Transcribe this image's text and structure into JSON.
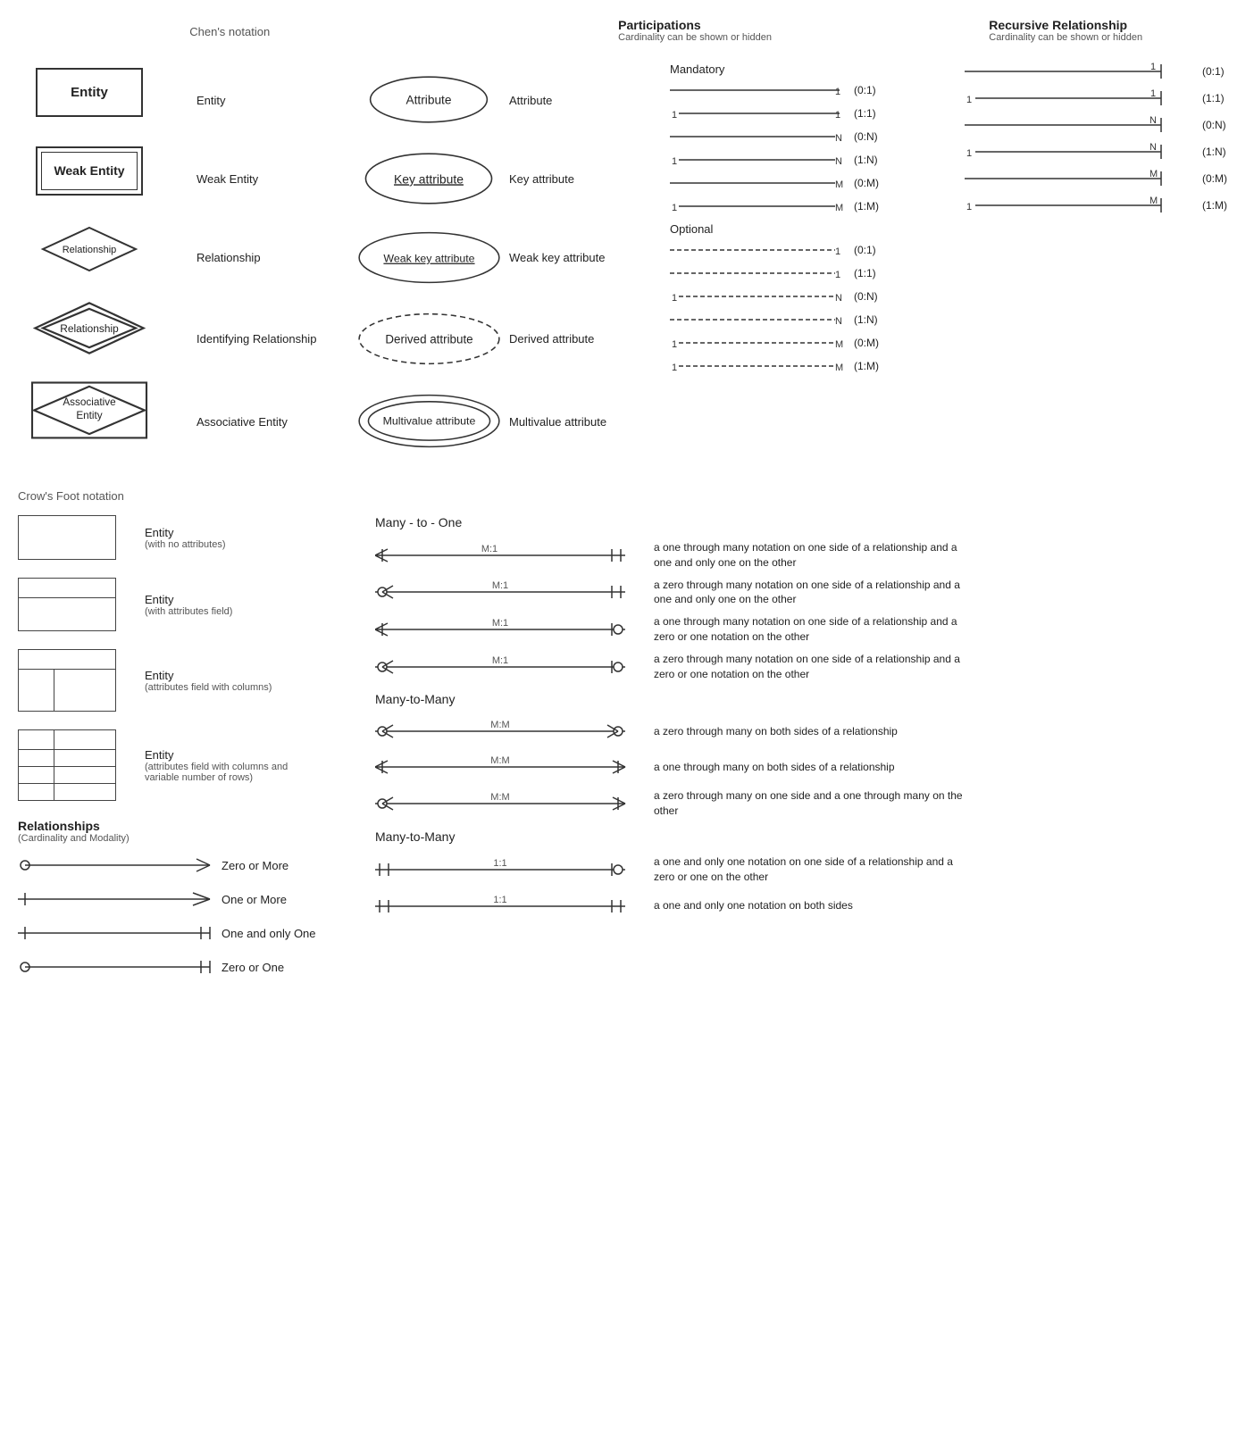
{
  "chens_notation_title": "Chen's notation",
  "crows_notation_title": "Crow's Foot notation",
  "participations_title": "Participations",
  "participations_subtitle": "Cardinality can be shown or hidden",
  "recursive_title": "Recursive Relationship",
  "recursive_subtitle": "Cardinality can be shown or hidden",
  "entities": [
    {
      "shape": "entity",
      "label": "Entity",
      "text": "Entity"
    },
    {
      "shape": "weak_entity",
      "label": "Weak Entity",
      "text": "Weak Entity"
    },
    {
      "shape": "relationship",
      "label": "Relationship",
      "text": "Relationship"
    },
    {
      "shape": "identifying_relationship",
      "label": "Identifying Relationship",
      "text": "Relationship"
    },
    {
      "shape": "associative_entity",
      "label": "Associative Entity",
      "text": "Associative\nEntity"
    }
  ],
  "attributes": [
    {
      "shape": "ellipse",
      "label": "Attribute",
      "text": "Attribute"
    },
    {
      "shape": "key_ellipse",
      "label": "Key attribute",
      "text": "Key attribute"
    },
    {
      "shape": "weak_key_ellipse",
      "label": "Weak key attribute",
      "text": "Weak key attribute"
    },
    {
      "shape": "dashed_ellipse",
      "label": "Derived attribute",
      "text": "Derived attribute"
    },
    {
      "shape": "double_ellipse",
      "label": "Multivalue attribute",
      "text": "Multivalue attribute"
    }
  ],
  "mandatory_rows": [
    {
      "left_num": "",
      "right_num": "1",
      "notation": "(0:1)"
    },
    {
      "left_num": "1",
      "right_num": "1",
      "notation": "(1:1)"
    },
    {
      "left_num": "",
      "right_num": "N",
      "notation": "(0:N)"
    },
    {
      "left_num": "1",
      "right_num": "N",
      "notation": "(1:N)"
    },
    {
      "left_num": "",
      "right_num": "M",
      "notation": "(0:M)"
    },
    {
      "left_num": "1",
      "right_num": "M",
      "notation": "(1:M)"
    }
  ],
  "optional_rows": [
    {
      "left_num": "",
      "right_num": "1",
      "notation": "(0:1)"
    },
    {
      "left_num": "",
      "right_num": "1",
      "notation": "(1:1)"
    },
    {
      "left_num": "1",
      "right_num": "N",
      "notation": "(0:N)"
    },
    {
      "left_num": "",
      "right_num": "N",
      "notation": "(1:N)"
    },
    {
      "left_num": "1",
      "right_num": "M",
      "notation": "(0:M)"
    },
    {
      "left_num": "1",
      "right_num": "M",
      "notation": "(1:M)"
    }
  ],
  "recursive_rows": [
    {
      "left_num": "",
      "right_num": "1",
      "notation": "(0:1)"
    },
    {
      "left_num": "1",
      "right_num": "1",
      "notation": "(1:1)"
    },
    {
      "left_num": "",
      "right_num": "N",
      "notation": "(0:N)"
    },
    {
      "left_num": "1",
      "right_num": "N",
      "notation": "(1:N)"
    },
    {
      "left_num": "",
      "right_num": "M",
      "notation": "(0:M)"
    },
    {
      "left_num": "1",
      "right_num": "M",
      "notation": "(1:M)"
    }
  ],
  "mandatory_label": "Mandatory",
  "optional_label": "Optional",
  "many_to_one_label": "Many - to - One",
  "many_to_many_label": "Many-to-Many",
  "many_to_many_label2": "Many-to-Many",
  "crows_entities": [
    {
      "type": "plain",
      "label": "Entity",
      "sublabel": "(with no attributes)"
    },
    {
      "type": "attrs",
      "label": "Entity",
      "sublabel": "(with attributes field)"
    },
    {
      "type": "cols",
      "label": "Entity",
      "sublabel": "(attributes field with columns)"
    },
    {
      "type": "varrows",
      "label": "Entity",
      "sublabel": "(attributes field with columns and\nvariable number of rows)"
    }
  ],
  "many_to_one_rows": [
    {
      "ratio": "M:1",
      "desc": "a one through many notation on one side of a relationship and a one and only one on the other"
    },
    {
      "ratio": "M:1",
      "desc": "a zero through many notation on one side of a relationship and a one and only one on the other"
    },
    {
      "ratio": "M:1",
      "desc": "a one through many notation on one side of a relationship and a zero or one notation on the other"
    },
    {
      "ratio": "M:1",
      "desc": "a zero through many notation on one side of a relationship and a zero or one notation on the other"
    }
  ],
  "many_to_many_rows": [
    {
      "ratio": "M:M",
      "desc": "a zero through many on both sides of a relationship"
    },
    {
      "ratio": "M:M",
      "desc": "a one through many on both sides of a relationship"
    },
    {
      "ratio": "M:M",
      "desc": "a zero through many on one side and a one through many on the other"
    }
  ],
  "one_to_one_rows": [
    {
      "ratio": "1:1",
      "desc": "a one and only one notation on one side of a relationship and a zero or one on the other"
    },
    {
      "ratio": "1:1",
      "desc": "a one and only one notation on both sides"
    }
  ],
  "relationships_card_title": "Relationships",
  "relationships_card_subtitle": "(Cardinality and Modality)",
  "rel_card_items": [
    {
      "label": "Zero or More"
    },
    {
      "label": "One or More"
    },
    {
      "label": "One and only One"
    },
    {
      "label": "Zero or One"
    }
  ]
}
